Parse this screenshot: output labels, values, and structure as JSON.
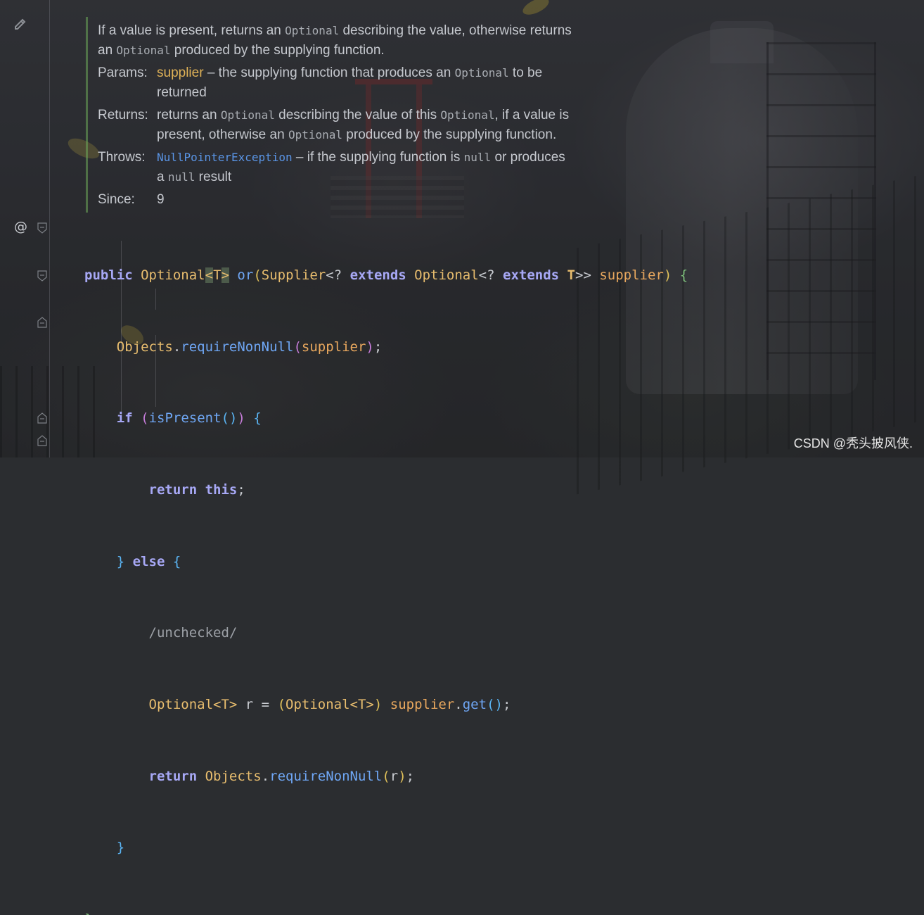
{
  "doc": {
    "summary_line1": [
      "If a value is present, returns an ",
      "Optional",
      " describing the value, otherwise returns"
    ],
    "summary_line2": [
      "an ",
      "Optional",
      " produced by the supplying function."
    ],
    "params_label": "Params:",
    "params_line1": [
      "supplier",
      " – the supplying function that produces an ",
      "Optional",
      " to be"
    ],
    "params_line2": "returned",
    "returns_label": "Returns:",
    "returns_line1": [
      "returns an ",
      "Optional",
      " describing the value of this ",
      "Optional",
      ", if a value is"
    ],
    "returns_line2": [
      "present, otherwise an ",
      "Optional",
      " produced by the supplying function."
    ],
    "throws_label": "Throws:",
    "throws_line1": [
      "NullPointerException",
      " – if the supplying function is ",
      "null",
      " or produces"
    ],
    "throws_line2": [
      "a ",
      "null",
      " result"
    ],
    "since_label": "Since:",
    "since_value": "9"
  },
  "gutter": {
    "annotation_marker": "@"
  },
  "code": {
    "l1": {
      "kw_public": "public",
      "type_optional": "Optional",
      "lt": "<",
      "tp": "T",
      "gt": ">",
      "sp": " ",
      "method": "or",
      "open": "(",
      "supplier_type": "Supplier",
      "lt2": "<",
      "q": "? ",
      "kw_extends": "extends",
      "opt2": "Optional",
      "lt3": "<",
      "q2": "? ",
      "kw_extends2": "extends",
      "tp2": "T",
      "gt2": ">>",
      "param": "supplier",
      "close": ")",
      "brace": "{"
    },
    "l2": {
      "cls": "Objects",
      "dot": ".",
      "call": "requireNonNull",
      "open": "(",
      "arg": "supplier",
      "close": ")",
      "semi": ";"
    },
    "l3": {
      "kw_if": "if",
      "open": "(",
      "call": "isPresent",
      "inner": "()",
      "close": ")",
      "brace": "{"
    },
    "l4": {
      "kw_return": "return",
      "kw_this": "this",
      "semi": ";"
    },
    "l5": {
      "brace_close": "}",
      "kw_else": "else",
      "brace": "{"
    },
    "l6": {
      "comment": "/unchecked/"
    },
    "l7": {
      "type": "Optional",
      "tp": "<T>",
      "rest": " r = ",
      "open": "(",
      "cast_type": "Optional",
      "cast_tp": "<T>",
      "close": ")",
      "param": "supplier",
      "dot": ".",
      "call": "get",
      "inner": "()",
      "semi": ";"
    },
    "l8": {
      "kw_return": "return",
      "cls": "Objects",
      "dot": ".",
      "call": "requireNonNull",
      "open": "(",
      "arg": "r",
      "close": ")",
      "semi": ";"
    },
    "l9": {
      "brace_close": "}"
    },
    "l10": {
      "brace_close": "}"
    }
  },
  "watermark": "CSDN @秃头披风侠."
}
